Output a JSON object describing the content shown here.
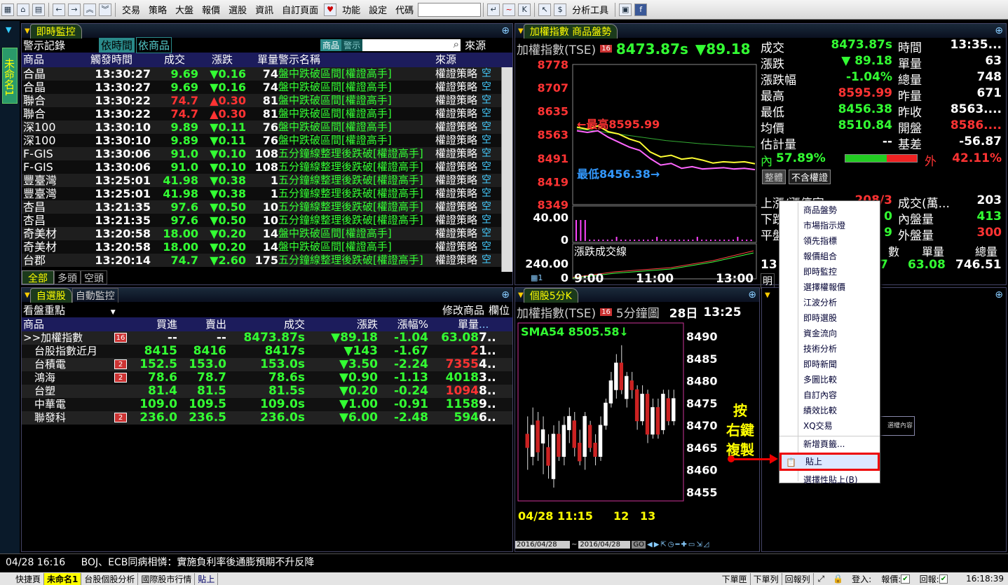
{
  "toolbar": {
    "menus": [
      "交易",
      "策略",
      "大盤",
      "報價",
      "選股",
      "資訊",
      "自訂頁面",
      "",
      "功能",
      "設定",
      "代碼"
    ],
    "analysis_tools": "分析工具"
  },
  "side_tab": "未命名1",
  "monitor": {
    "title": "即時監控",
    "subtitle": "警示記錄",
    "btn_time": "依時間",
    "btn_product": "依商品",
    "seg_a": "商品",
    "seg_b": "警示",
    "source_label": "來源",
    "cols": [
      "商品",
      "觸發時間",
      "成交",
      "漲跌",
      "單量",
      "警示名稱",
      "來源"
    ],
    "rows": [
      [
        "合晶",
        "13:30:27",
        "9.69",
        "▼0.16",
        "74",
        "盤中跌破區間[權證高手]",
        "權證策略",
        "空"
      ],
      [
        "合晶",
        "13:30:27",
        "9.69",
        "▼0.16",
        "74",
        "盤中跌破區間[權證高手]",
        "權證策略",
        "空"
      ],
      [
        "聯合",
        "13:30:22",
        "74.7",
        "▲0.30",
        "81",
        "盤中跌破區間[權證高手]",
        "權證策略",
        "空"
      ],
      [
        "聯合",
        "13:30:22",
        "74.7",
        "▲0.30",
        "81",
        "盤中跌破區間[權證高手]",
        "權證策略",
        "空"
      ],
      [
        "深100",
        "13:30:10",
        "9.89",
        "▼0.11",
        "76",
        "盤中跌破區間[權證高手]",
        "權證策略",
        "空"
      ],
      [
        "深100",
        "13:30:10",
        "9.89",
        "▼0.11",
        "76",
        "盤中跌破區間[權證高手]",
        "權證策略",
        "空"
      ],
      [
        "F-GIS",
        "13:30:06",
        "91.0",
        "▼0.10",
        "108",
        "五分鐘線整理後跌破[權證高手]",
        "權證策略",
        "空"
      ],
      [
        "F-GIS",
        "13:30:06",
        "91.0",
        "▼0.10",
        "108",
        "五分鐘線整理後跌破[權證高手]",
        "權證策略",
        "空"
      ],
      [
        "豐臺灣",
        "13:25:01",
        "41.98",
        "▼0.38",
        "1",
        "五分鐘線整理後跌破[權證高手]",
        "權證策略",
        "空"
      ],
      [
        "豐臺灣",
        "13:25:01",
        "41.98",
        "▼0.38",
        "1",
        "五分鐘線整理後跌破[權證高手]",
        "權證策略",
        "空"
      ],
      [
        "杏昌",
        "13:21:35",
        "97.6",
        "▼0.50",
        "10",
        "五分鐘線整理後跌破[權證高手]",
        "權證策略",
        "空"
      ],
      [
        "杏昌",
        "13:21:35",
        "97.6",
        "▼0.50",
        "10",
        "五分鐘線整理後跌破[權證高手]",
        "權證策略",
        "空"
      ],
      [
        "奇美材",
        "13:20:58",
        "18.00",
        "▼0.20",
        "14",
        "盤中跌破區間[權證高手]",
        "權證策略",
        "空"
      ],
      [
        "奇美材",
        "13:20:58",
        "18.00",
        "▼0.20",
        "14",
        "盤中跌破區間[權證高手]",
        "權證策略",
        "空"
      ],
      [
        "台郡",
        "13:20:14",
        "74.7",
        "▼2.60",
        "175",
        "五分鐘線整理後跌破[權證高手]",
        "權證策略",
        "空"
      ]
    ],
    "bottom_tabs": [
      "全部",
      "多頭",
      "空頭"
    ]
  },
  "index": {
    "tab1": "加權指數",
    "tab2": "商品盤勢",
    "name": "加權指數(TSE)",
    "price": "8473.87s",
    "change": "▼89.18",
    "yticks": [
      "8778",
      "8707",
      "8635",
      "8563",
      "8491",
      "8419",
      "8349"
    ],
    "high_label": "←最高8595.99",
    "low_label": "最低8456.38→",
    "vol_ticks": [
      "40.00",
      "0"
    ],
    "vol2_ticks": [
      "240.00",
      "0"
    ],
    "vol2_label": "漲跌成交線",
    "xticks": [
      "9:00",
      "11:00",
      "13:00"
    ],
    "stats": [
      [
        "成交",
        "8473.87s",
        "時間",
        "13:35..."
      ],
      [
        "漲跌",
        "▼ 89.18",
        "單量",
        "63"
      ],
      [
        "漲跌幅",
        "-1.04%",
        "總量",
        "748"
      ],
      [
        "最高",
        "8595.99",
        "昨量",
        "671"
      ],
      [
        "最低",
        "8456.38",
        "昨收",
        "8563...."
      ],
      [
        "均價",
        "8510.84",
        "開盤",
        "8586...."
      ],
      [
        "估計量",
        "--",
        "基差",
        "-56.87"
      ]
    ],
    "inner": "內",
    "inner_pct": "57.89%",
    "outer": "外",
    "outer_pct": "42.11%",
    "btn1": "整體",
    "btn2": "不含權證",
    "stats2": [
      [
        "上漲/漲停家",
        "208/3",
        "成交(萬...",
        "203"
      ],
      [
        "下跌",
        "0",
        "內盤量",
        "413"
      ],
      [
        "平盤",
        "9",
        "外盤量",
        "300"
      ]
    ],
    "bottom": [
      "數",
      "單量",
      "總量"
    ],
    "bottom_vals": [
      "13",
      "7",
      "63.08",
      "746.51"
    ],
    "bottom_tab": "明"
  },
  "watch": {
    "tab1": "自選股",
    "tab2": "自動監控",
    "focus": "看盤重點",
    "edit": "修改商品",
    "cols_btn": "欄位",
    "cols": [
      "商品",
      "買進",
      "賣出",
      "成交",
      "漲跌",
      "漲幅%",
      "單量"
    ],
    "rows": [
      [
        ">>加權指數",
        "16",
        "--",
        "--",
        "8473.87s",
        "▼89.18",
        "-1.04",
        "63.08",
        "7.."
      ],
      [
        "台股指數近月",
        "",
        "8415",
        "8416",
        "8417s",
        "▼143",
        "-1.67",
        "2",
        "1.."
      ],
      [
        "台積電",
        "2",
        "152.5",
        "153.0",
        "153.0s",
        "▼3.50",
        "-2.24",
        "7355",
        "4.."
      ],
      [
        "鴻海",
        "2",
        "78.6",
        "78.7",
        "78.6s",
        "▼0.90",
        "-1.13",
        "4018",
        "3.."
      ],
      [
        "台塑",
        "",
        "81.4",
        "81.5",
        "81.5s",
        "▼0.20",
        "-0.24",
        "1094",
        "8.."
      ],
      [
        "中華電",
        "",
        "109.0",
        "109.5",
        "109.0s",
        "▼1.00",
        "-0.91",
        "1158",
        "9.."
      ],
      [
        "聯發科",
        "2",
        "236.0",
        "236.5",
        "236.0s",
        "▼6.00",
        "-2.48",
        "594",
        "6.."
      ]
    ]
  },
  "kline": {
    "tab": "個股5分K",
    "name": "加權指數(TSE)",
    "badge": "16",
    "period": "5分鐘圖",
    "day": "28日",
    "time": "13:25",
    "sma": "SMA54 8505.58↓",
    "yticks": [
      "8490",
      "8485",
      "8480",
      "8475",
      "8470",
      "8465",
      "8460",
      "8455"
    ],
    "xticks": [
      "04/28 11:15",
      "12",
      "13"
    ],
    "date1": "2016/04/28",
    "date2": "2016/04/28"
  },
  "note": {
    "l1": "按",
    "l2": "右鍵",
    "l3": "複製"
  },
  "ctx": {
    "items": [
      "商品盤勢",
      "市場指示燈",
      "領先指標",
      "報價組合",
      "即時監控",
      "選擇權報價",
      "江波分析",
      "即時選股",
      "資金流向",
      "技術分析",
      "即時新聞",
      "多圖比較",
      "自訂內容",
      "績效比較",
      "XQ交易",
      "新增頁籤...",
      "貼上",
      "選擇性貼上(B)"
    ],
    "behind": "選權內容"
  },
  "status": {
    "time": "04/28 16:16",
    "news": "BOJ、ECB同病相憐：實施負利率後通膨預期不升反降"
  },
  "bottom": {
    "tabs": [
      "快捷頁",
      "未命名1",
      "台股個股分析",
      "國際股市行情",
      "貼上"
    ],
    "right": [
      "下單匣",
      "下單列",
      "回報列"
    ],
    "login": "登入:",
    "quote": "報價:",
    "report": "回報:",
    "time": "16:18:39"
  }
}
